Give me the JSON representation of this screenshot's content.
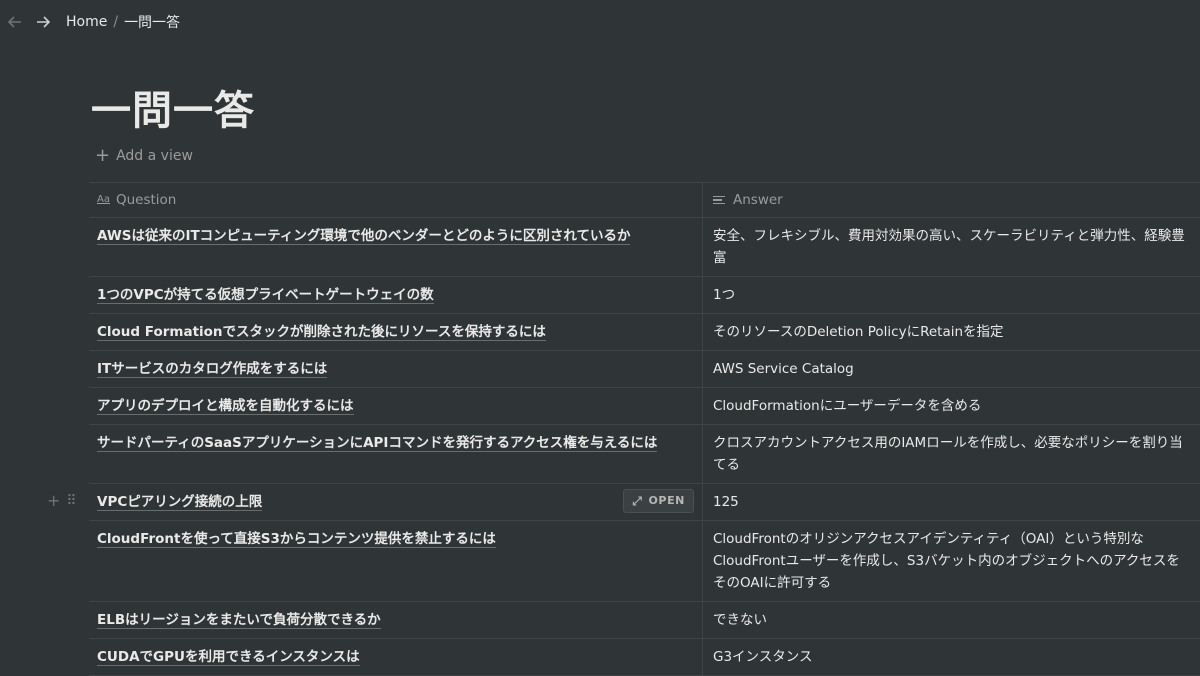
{
  "breadcrumb": {
    "home": "Home",
    "separator": "/",
    "current": "一問一答"
  },
  "page": {
    "title": "一問一答",
    "add_view_label": "Add a view"
  },
  "table": {
    "columns": {
      "question": {
        "icon": "Aa",
        "label": "Question"
      },
      "answer": {
        "icon": "text-lines-icon",
        "label": "Answer"
      }
    },
    "open_label": "OPEN",
    "rows": [
      {
        "question": "AWSは従来のITコンピューティング環境で他のベンダーとどのように区別されているか",
        "answer": "安全、フレキシブル、費用対効果の高い、スケーラビリティと弾力性、経験豊富"
      },
      {
        "question": "1つのVPCが持てる仮想プライベートゲートウェイの数",
        "answer": "1つ"
      },
      {
        "question": "Cloud Formationでスタックが削除された後にリソースを保持するには",
        "answer": "そのリソースのDeletion PolicyにRetainを指定"
      },
      {
        "question": "ITサービスのカタログ作成をするには",
        "answer": "AWS Service Catalog"
      },
      {
        "question": "アプリのデプロイと構成を自動化するには",
        "answer": "CloudFormationにユーザーデータを含める"
      },
      {
        "question": "サードパーティのSaaSアプリケーションにAPIコマンドを発行するアクセス権を与えるには",
        "answer": "クロスアカウントアクセス用のIAMロールを作成し、必要なポリシーを割り当てる"
      },
      {
        "question": "VPCピアリング接続の上限",
        "answer": "125"
      },
      {
        "question": "CloudFrontを使って直接S3からコンテンツ提供を禁止するには",
        "answer": "CloudFrontのオリジンアクセスアイデンティティ（OAI）という特別なCloudFrontユーザーを作成し、S3バケット内のオブジェクトへのアクセスをそのOAIに許可する"
      },
      {
        "question": "ELBはリージョンをまたいで負荷分散できるか",
        "answer": "できない"
      },
      {
        "question": "CUDAでGPUを利用できるインスタンスは",
        "answer": "G3インスタンス"
      }
    ]
  }
}
